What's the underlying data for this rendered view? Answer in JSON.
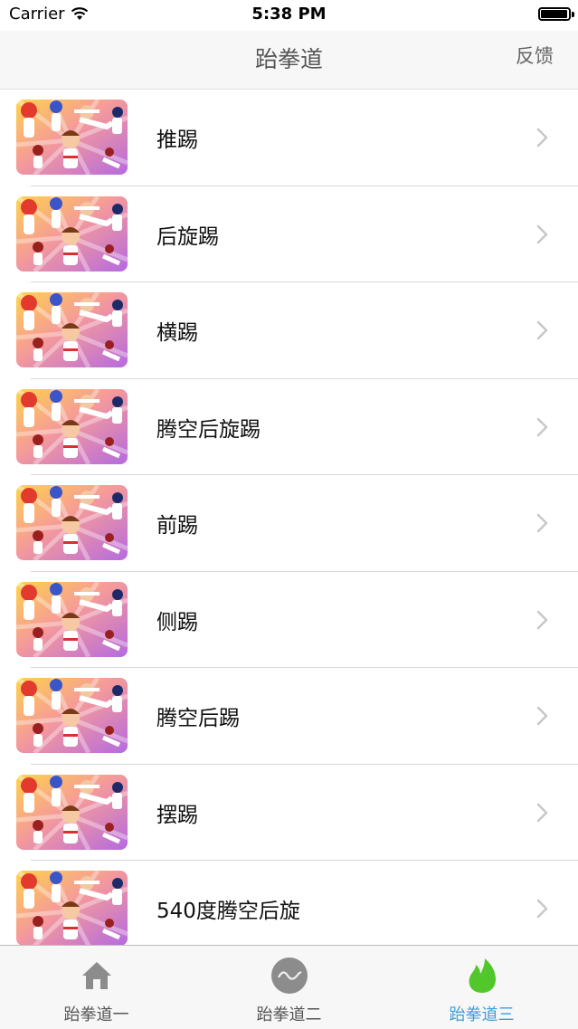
{
  "status_bar": {
    "carrier": "Carrier",
    "time": "5:38 PM",
    "battery_level_fraction": 0.95
  },
  "nav_bar": {
    "title": "跆拳道",
    "right_button": "反馈"
  },
  "list": {
    "items": [
      {
        "label": "推踢"
      },
      {
        "label": "后旋踢"
      },
      {
        "label": "横踢"
      },
      {
        "label": "腾空后旋踢"
      },
      {
        "label": "前踢"
      },
      {
        "label": "侧踢"
      },
      {
        "label": "腾空后踢"
      },
      {
        "label": "摆踢"
      },
      {
        "label": "540度腾空后旋"
      }
    ],
    "thumbnail_icon": "taekwondo-cartoon-thumbnail",
    "disclosure_icon": "chevron-right-icon"
  },
  "tab_bar": {
    "tabs": [
      {
        "label": "跆拳道一",
        "icon": "home-icon",
        "active": false
      },
      {
        "label": "跆拳道二",
        "icon": "wave-circle-icon",
        "active": false
      },
      {
        "label": "跆拳道三",
        "icon": "flame-icon",
        "active": true
      }
    ],
    "active_color": "#3e9ed8",
    "inactive_color": "#555555"
  }
}
